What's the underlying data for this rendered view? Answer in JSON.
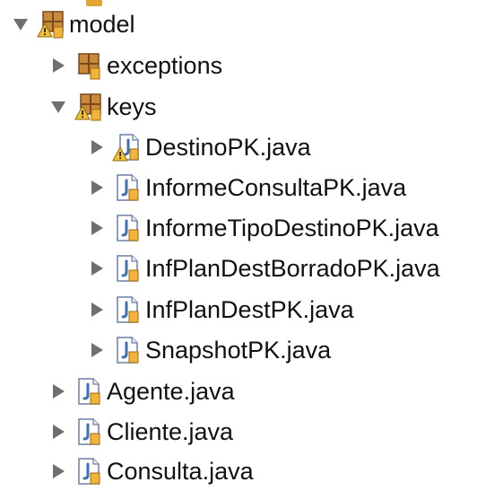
{
  "tree": {
    "model": {
      "label": "model",
      "expanded": true,
      "icon": "package-icon",
      "warning": true
    },
    "exceptions": {
      "label": "exceptions",
      "expanded": false,
      "icon": "package-icon",
      "warning": false
    },
    "keys": {
      "label": "keys",
      "expanded": true,
      "icon": "package-icon",
      "warning": true
    },
    "key_files": [
      {
        "label": "DestinoPK.java",
        "icon": "java-file-icon",
        "warning": true
      },
      {
        "label": "InformeConsultaPK.java",
        "icon": "java-file-icon",
        "warning": false
      },
      {
        "label": "InformeTipoDestinoPK.java",
        "icon": "java-file-icon",
        "warning": false
      },
      {
        "label": "InfPlanDestBorradoPK.java",
        "icon": "java-file-icon",
        "warning": false
      },
      {
        "label": "InfPlanDestPK.java",
        "icon": "java-file-icon",
        "warning": false
      },
      {
        "label": "SnapshotPK.java",
        "icon": "java-file-icon",
        "warning": false
      }
    ],
    "model_files": [
      {
        "label": "Agente.java",
        "icon": "java-file-icon",
        "warning": false
      },
      {
        "label": "Cliente.java",
        "icon": "java-file-icon",
        "warning": false
      },
      {
        "label": "Consulta.java",
        "icon": "java-file-icon",
        "warning": false
      }
    ]
  },
  "colors": {
    "twisty": "#6f6f6f",
    "package_brown": "#8b5a2b",
    "package_orange": "#e2a432",
    "java_blue": "#3f6fb5",
    "warning_yellow": "#f2c230"
  }
}
